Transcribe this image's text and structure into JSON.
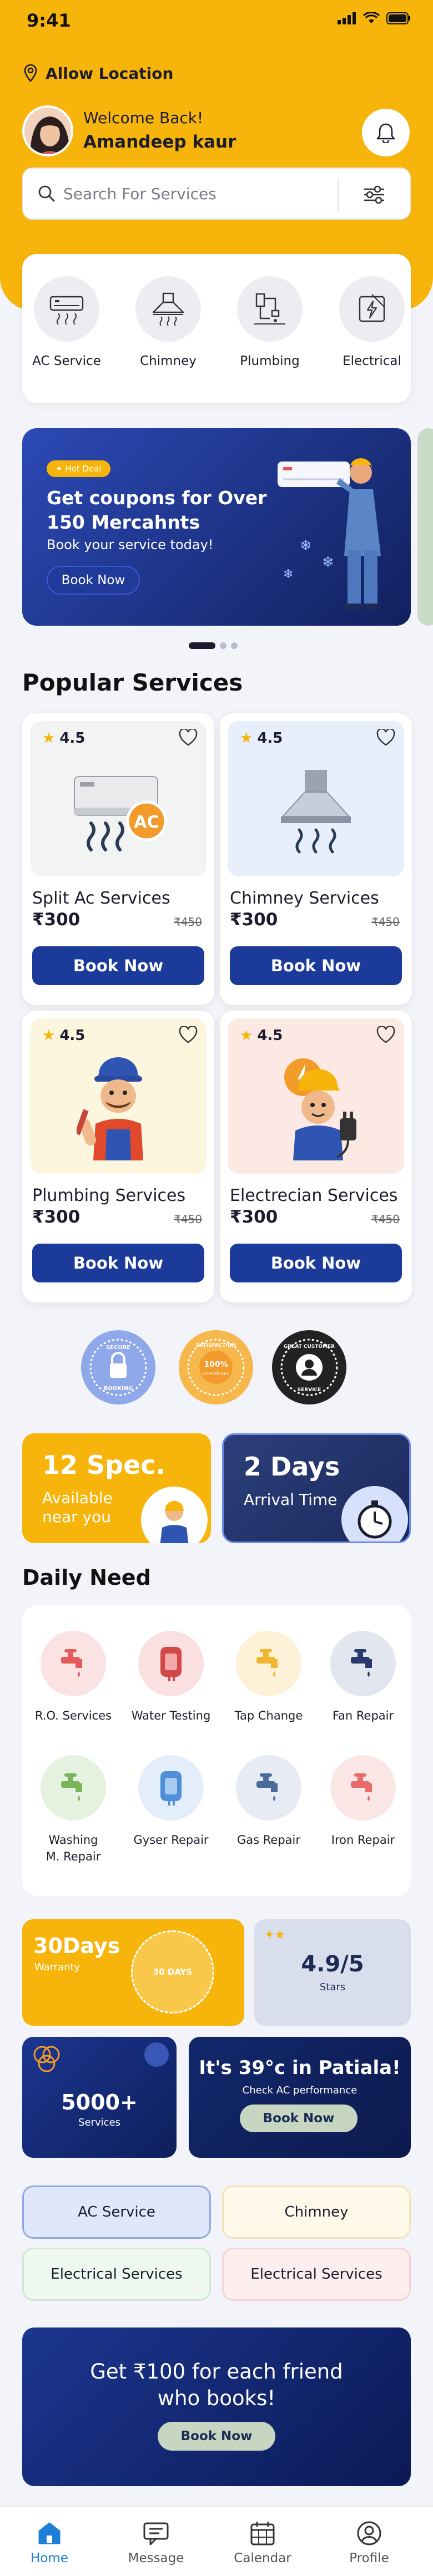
{
  "status_bar": {
    "time": "9:41"
  },
  "location": {
    "label": "Allow Location"
  },
  "user": {
    "greeting": "Welcome Back!",
    "name": "Amandeep kaur"
  },
  "search": {
    "placeholder": "Search For Services"
  },
  "categories": [
    {
      "label": "AC Service",
      "icon": "ac-unit-icon"
    },
    {
      "label": "Chimney",
      "icon": "chimney-icon"
    },
    {
      "label": "Plumbing",
      "icon": "plumbing-icon"
    },
    {
      "label": "Electrical",
      "icon": "electrical-icon"
    }
  ],
  "banner": {
    "tag": "Hot Deal",
    "title": "Get coupons for Over 150 Mercahnts",
    "subtitle": "Book your service today!",
    "button": "Book Now"
  },
  "popular": {
    "title": "Popular Services",
    "items": [
      {
        "rating": "4.5",
        "name": "Split Ac Services",
        "price": "₹300",
        "old_price": "₹450",
        "button": "Book Now",
        "bg": "#f2f3f3",
        "icon": "split-ac-icon",
        "icon_text": "AC"
      },
      {
        "rating": "4.5",
        "name": "Chimney Services",
        "price": "₹300",
        "old_price": "₹450",
        "button": "Book Now",
        "bg": "#e8effc",
        "icon": "chimney-hood-icon"
      },
      {
        "rating": "4.5",
        "name": "Plumbing Services",
        "price": "₹300",
        "old_price": "₹450",
        "button": "Book Now",
        "bg": "#fdf6df",
        "icon": "plumber-icon"
      },
      {
        "rating": "4.5",
        "name": "Electrecian Services",
        "price": "₹300",
        "old_price": "₹450",
        "button": "Book Now",
        "bg": "#fde9e4",
        "icon": "electrician-icon"
      }
    ]
  },
  "badges": [
    {
      "text": "SECURE BOOKING",
      "color": "#8ea8ea",
      "icon": "secure-booking-badge-icon"
    },
    {
      "text": "100% SATISFACTION GUARANTEED",
      "color": "#f6b84d",
      "icon": "satisfaction-badge-icon"
    },
    {
      "text": "GREAT CUSTOMER SERVICE",
      "color": "#222",
      "icon": "customer-service-badge-icon"
    }
  ],
  "stats": [
    {
      "title": "12 Spec.",
      "subtitle": "Available near you"
    },
    {
      "title": "2 Days",
      "subtitle": "Arrival Time"
    }
  ],
  "daily": {
    "title": "Daily Need",
    "items": [
      {
        "label": "R.O. Services",
        "bg": "#fbe3e3",
        "color": "#e35b5b"
      },
      {
        "label": "Water Testing",
        "bg": "#fae0e0",
        "color": "#d24848"
      },
      {
        "label": "Tap Change",
        "bg": "#fdf2d8",
        "color": "#f2b530"
      },
      {
        "label": "Fan Repair",
        "bg": "#e3e6ee",
        "color": "#2b3a6e"
      },
      {
        "label": "Washing M. Repair",
        "bg": "#e6f2e0",
        "color": "#7bb35a"
      },
      {
        "label": "Gyser Repair",
        "bg": "#e3eefa",
        "color": "#4e8fd8"
      },
      {
        "label": "Gas Repair",
        "bg": "#e6ebf4",
        "color": "#4a6a9c"
      },
      {
        "label": "Iron Repair",
        "bg": "#fbe6e6",
        "color": "#e86a6a"
      }
    ]
  },
  "promos": {
    "warranty": {
      "title": "30Days",
      "subtitle": "Warranty",
      "seal": "30 DAYS"
    },
    "rating": {
      "value": "4.9/5",
      "label": "Stars"
    },
    "services": {
      "value": "5000+",
      "label": "Services"
    },
    "weather": {
      "title": "It's 39°c in Patiala!",
      "subtitle": "Check AC performance",
      "button": "Book Now"
    }
  },
  "chips": [
    {
      "label": "AC Service",
      "bg": "#dfe7fb",
      "border": "#93a9e6"
    },
    {
      "label": "Chimney",
      "bg": "#fff9ea",
      "border": "#f3e3b8"
    },
    {
      "label": "Electrical Services",
      "bg": "#eef8ef",
      "border": "#cde8d0"
    },
    {
      "label": "Electrical Services",
      "bg": "#fdeeee",
      "border": "#f4d4d4"
    }
  ],
  "referral": {
    "title": "Get ₹100 for each friend who books!",
    "button": "Book Now"
  },
  "nav": [
    {
      "label": "Home",
      "icon": "home-icon",
      "active": true
    },
    {
      "label": "Message",
      "icon": "message-icon",
      "active": false
    },
    {
      "label": "Calendar",
      "icon": "calendar-icon",
      "active": false
    },
    {
      "label": "Profile",
      "icon": "profile-icon",
      "active": false
    }
  ],
  "colors": {
    "accent": "#f7b40a",
    "primary": "#1c3a99",
    "nav_active": "#1d7fd6"
  }
}
